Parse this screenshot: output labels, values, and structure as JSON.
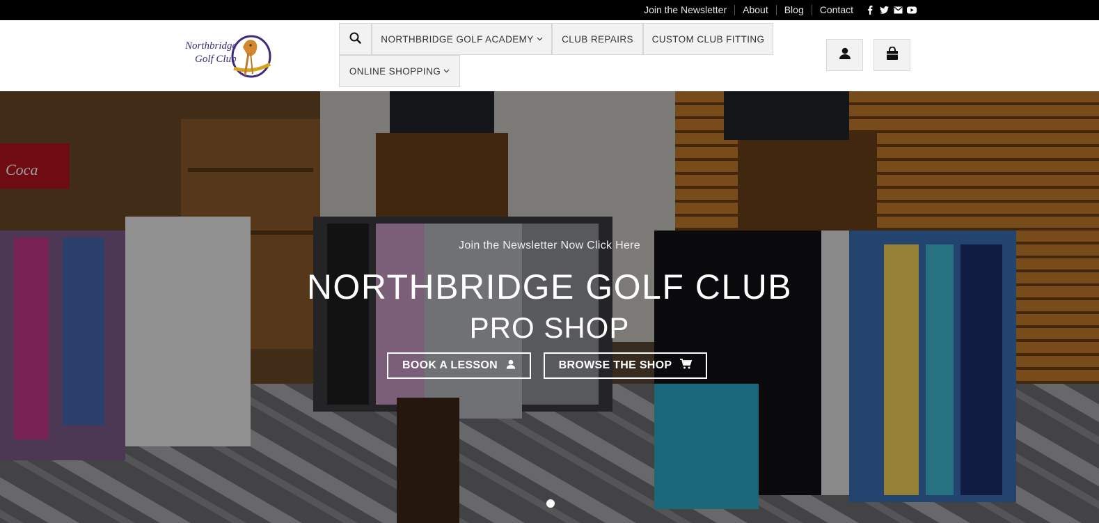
{
  "topbar": {
    "links": [
      "Join the Newsletter",
      "About",
      "Blog",
      "Contact"
    ],
    "social_icons": [
      "facebook-icon",
      "twitter-icon",
      "email-icon",
      "youtube-icon"
    ]
  },
  "logo": {
    "line1": "Northbridge",
    "line2": "Golf Club"
  },
  "nav": {
    "search_icon": "search-icon",
    "items": [
      {
        "label": "NORTHBRIDGE GOLF ACADEMY",
        "has_dropdown": true
      },
      {
        "label": "CLUB REPAIRS",
        "has_dropdown": false
      },
      {
        "label": "CUSTOM CLUB FITTING",
        "has_dropdown": false
      },
      {
        "label": "ONLINE SHOPPING",
        "has_dropdown": true
      }
    ],
    "account_icon": "user-icon",
    "cart_icon": "shopping-bag-icon"
  },
  "hero": {
    "newsletter_text": "Join the Newsletter Now Click Here",
    "title": "NORTHBRIDGE GOLF CLUB",
    "subtitle": "PRO SHOP",
    "buttons": [
      {
        "label": "BOOK A LESSON",
        "icon": "user-icon"
      },
      {
        "label": "BROWSE THE SHOP",
        "icon": "cart-icon"
      }
    ],
    "slide_dots": 1,
    "active_slide": 1
  },
  "colors": {
    "topbar_bg": "#000000",
    "nav_bg": "#f2f2f2",
    "logo_purple": "#3c2a7a",
    "logo_gold": "#d9a21b"
  }
}
